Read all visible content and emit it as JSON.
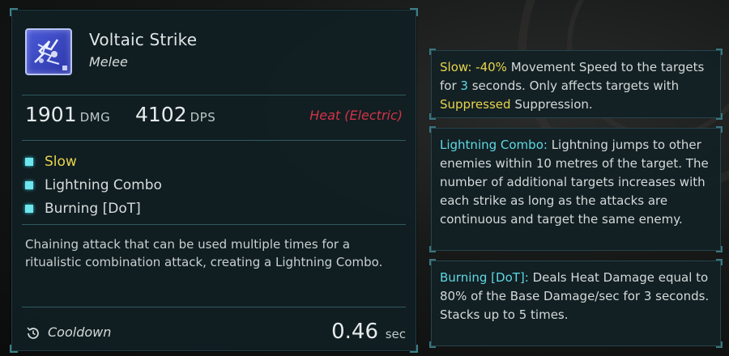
{
  "skill": {
    "name": "Voltaic Strike",
    "category": "Melee",
    "icon": "lightning-skill-icon"
  },
  "stats": {
    "damage_value": "1901",
    "damage_unit": "DMG",
    "dps_value": "4102",
    "dps_unit": "DPS",
    "damage_type": "Heat (Electric)"
  },
  "effects": [
    {
      "label": "Slow",
      "highlight": true
    },
    {
      "label": "Lightning Combo",
      "highlight": false
    },
    {
      "label": "Burning [DoT]",
      "highlight": false
    }
  ],
  "description": "Chaining attack that can be used multiple times for a ritualistic combination attack, creating a Lightning Combo.",
  "cooldown": {
    "label": "Cooldown",
    "value": "0.46",
    "unit": "sec",
    "icon": "cooldown-clock-icon"
  },
  "info_boxes": {
    "slow": {
      "keyword": "Slow:",
      "value": "-40%",
      "text_a": "Movement Speed to the targets for",
      "duration": "3",
      "text_b": "seconds. Only affects targets with",
      "status": "Suppressed",
      "text_c": "Suppression."
    },
    "lightning": {
      "keyword": "Lightning Combo:",
      "text": "Lightning jumps to other enemies within 10 metres of the target. The number of additional targets increases with each strike as long as the attacks are continuous and target the same enemy."
    },
    "burning": {
      "keyword": "Burning [DoT]:",
      "text": "Deals Heat Damage equal to 80% of the Base Damage/sec for 3 seconds. Stacks up to 5 times."
    }
  },
  "colors": {
    "accent_cyan": "#5fd9e3",
    "highlight_gold": "#e8d44d",
    "damage_type_red": "#d23347",
    "panel_bg": "#101e22"
  }
}
